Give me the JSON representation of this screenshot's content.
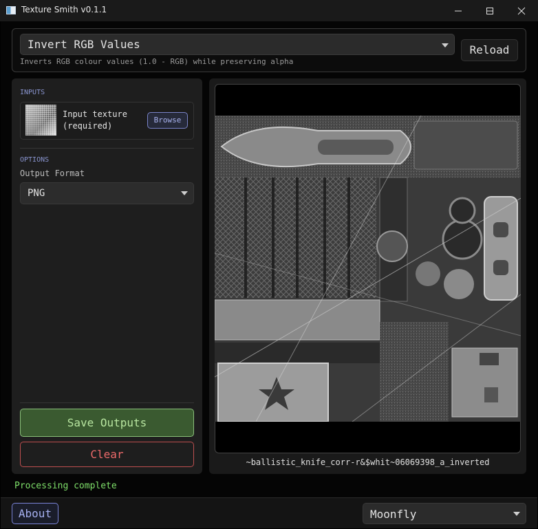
{
  "window": {
    "title": "Texture Smith v0.1.1"
  },
  "operation": {
    "selected": "Invert RGB Values",
    "description": "Inverts RGB colour values (1.0 - RGB) while preserving alpha",
    "reload_label": "Reload"
  },
  "inputs": {
    "section_label": "INPUTS",
    "texture_label_line1": "Input texture",
    "texture_label_line2": "(required)",
    "browse_label": "Browse"
  },
  "options": {
    "section_label": "OPTIONS",
    "output_format_label": "Output Format",
    "output_format_value": "PNG"
  },
  "actions": {
    "save_label": "Save Outputs",
    "clear_label": "Clear"
  },
  "preview": {
    "caption": "~ballistic_knife_corr-r&$whit~06069398_a_inverted"
  },
  "status": {
    "text": "Processing complete"
  },
  "footer": {
    "about_label": "About",
    "theme_value": "Moonfly"
  }
}
